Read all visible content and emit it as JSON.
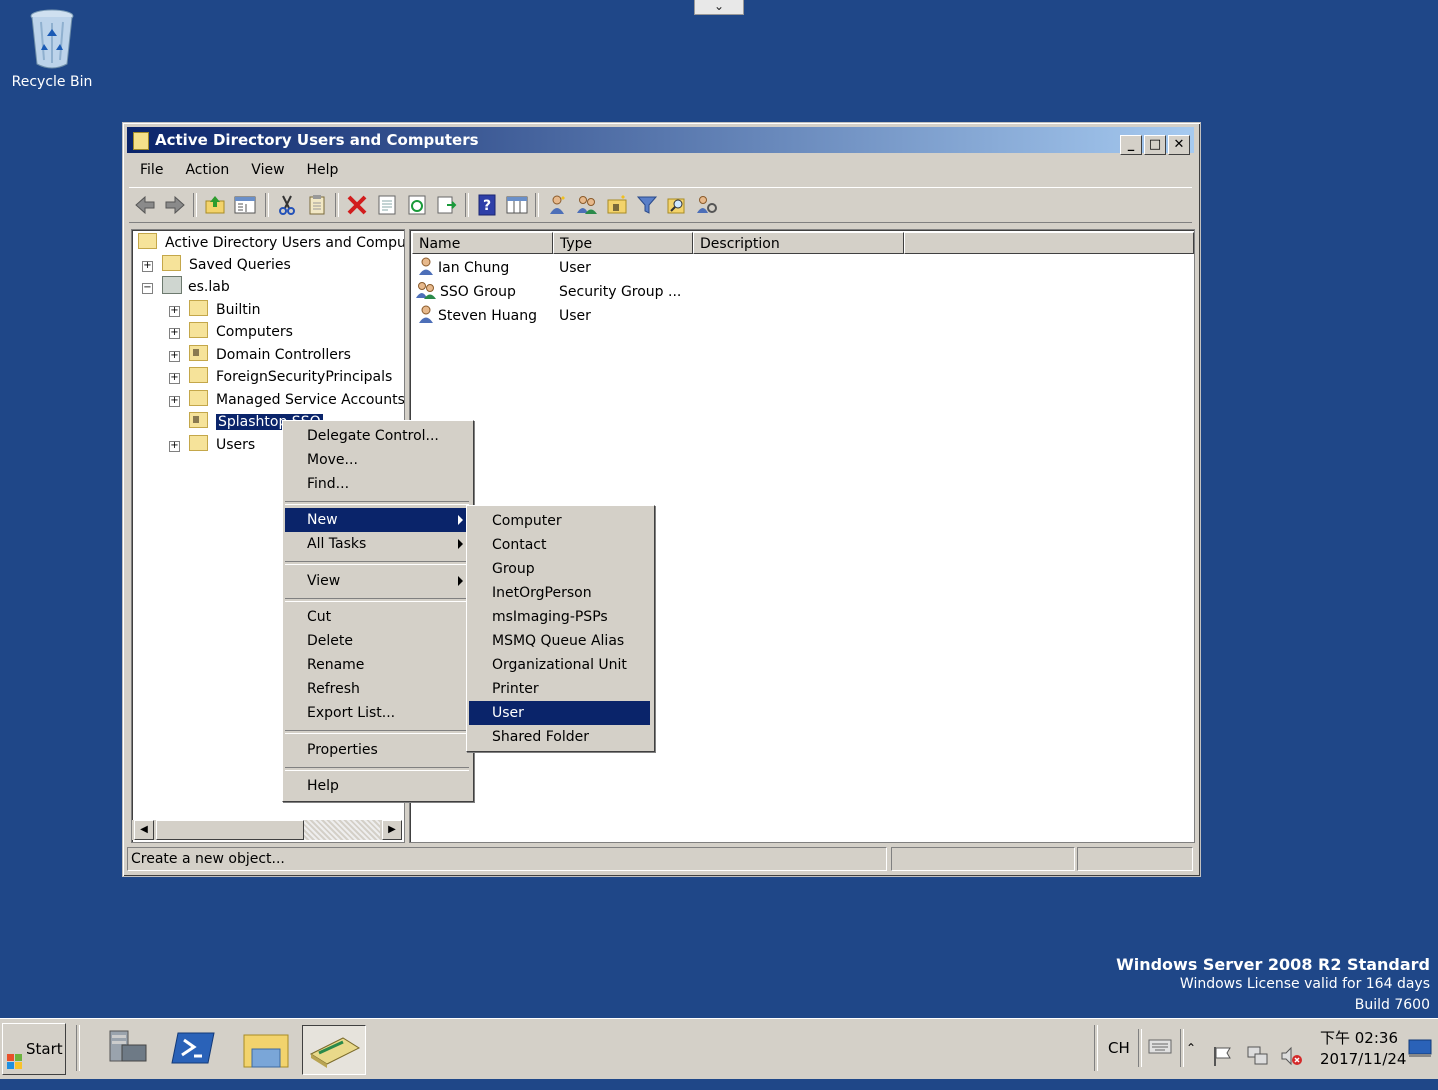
{
  "desktop": {
    "recycle_bin_label": "Recycle Bin",
    "top_tab_glyph": "⌄",
    "watermark": {
      "edition": "Windows Server 2008 R2 Standard",
      "license": "Windows License valid for 164 days",
      "build": "Build 7600"
    }
  },
  "window": {
    "title": "Active Directory Users and Computers",
    "menu": [
      "File",
      "Action",
      "View",
      "Help"
    ],
    "toolbar_icons": [
      "back-icon",
      "forward-icon",
      "up-folder-icon",
      "show-hide-tree-icon",
      "cut-icon",
      "copy-icon",
      "delete-icon",
      "properties-icon",
      "refresh-icon",
      "export-list-icon",
      "help-icon",
      "console-tree-icon",
      "new-user-icon",
      "new-group-icon",
      "new-ou-icon",
      "filter-icon",
      "find-icon",
      "add-to-group-icon"
    ],
    "tree": {
      "root": "Active Directory Users and Comput",
      "saved_queries": "Saved Queries",
      "domain": "es.lab",
      "children": [
        "Builtin",
        "Computers",
        "Domain Controllers",
        "ForeignSecurityPrincipals",
        "Managed Service Accounts",
        "Splashtop SSO",
        "Users"
      ]
    },
    "list": {
      "columns": [
        "Name",
        "Type",
        "Description"
      ],
      "rows": [
        {
          "name": "Ian Chung",
          "type": "User",
          "icon": "user-icon"
        },
        {
          "name": "SSO Group",
          "type": "Security Group ...",
          "icon": "group-icon"
        },
        {
          "name": "Steven Huang",
          "type": "User",
          "icon": "user-icon"
        }
      ]
    },
    "status": "Create a new object..."
  },
  "context_menu": {
    "items": [
      "Delegate Control...",
      "Move...",
      "Find...",
      "New",
      "All Tasks",
      "View",
      "Cut",
      "Delete",
      "Rename",
      "Refresh",
      "Export List...",
      "Properties",
      "Help"
    ],
    "highlighted": "New"
  },
  "submenu_new": {
    "items": [
      "Computer",
      "Contact",
      "Group",
      "InetOrgPerson",
      "msImaging-PSPs",
      "MSMQ Queue Alias",
      "Organizational Unit",
      "Printer",
      "User",
      "Shared Folder"
    ],
    "highlighted": "User"
  },
  "taskbar": {
    "start_label": "Start",
    "quick_launch": [
      "server-manager-icon",
      "powershell-icon",
      "explorer-icon",
      "ad-users-computers-icon"
    ],
    "language": "CH",
    "time": "下午 02:36",
    "date": "2017/11/24"
  },
  "colors": {
    "desktop": "#1f4788",
    "selection": "#0a246a",
    "window_face": "#d4d0c8"
  }
}
